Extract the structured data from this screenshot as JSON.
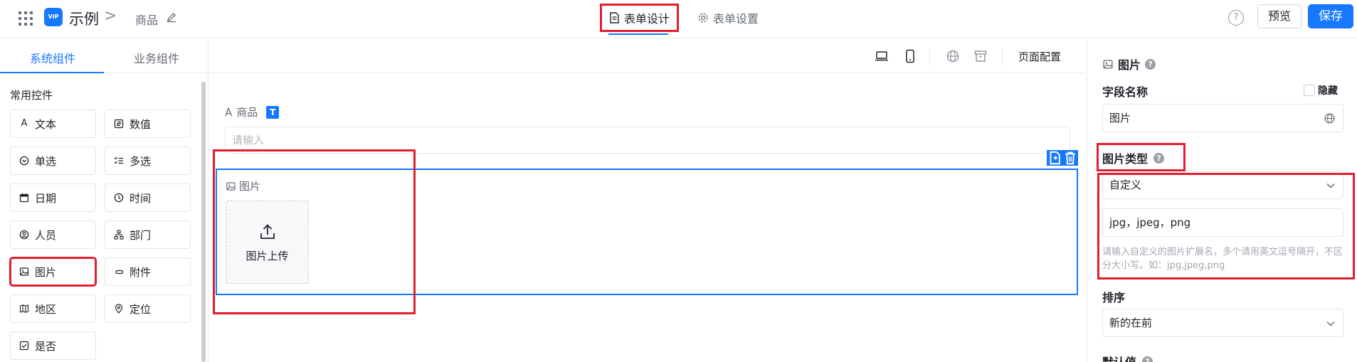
{
  "header": {
    "app_logo_text": "VIP",
    "app_title": "示例",
    "breadcrumb_separator": ">",
    "page_name": "商品",
    "tabs": [
      {
        "label": "表单设计"
      },
      {
        "label": "表单设置"
      }
    ],
    "help_glyph": "?",
    "preview_label": "预览",
    "save_label": "保存"
  },
  "sidebar": {
    "tabs": [
      {
        "label": "系统组件"
      },
      {
        "label": "业务组件"
      }
    ],
    "group_title": "常用控件",
    "components": [
      {
        "label": "文本",
        "icon": "text-icon"
      },
      {
        "label": "数值",
        "icon": "number-icon"
      },
      {
        "label": "单选",
        "icon": "radio-icon"
      },
      {
        "label": "多选",
        "icon": "checklist-icon"
      },
      {
        "label": "日期",
        "icon": "calendar-icon"
      },
      {
        "label": "时间",
        "icon": "clock-icon"
      },
      {
        "label": "人员",
        "icon": "user-icon"
      },
      {
        "label": "部门",
        "icon": "org-icon"
      },
      {
        "label": "图片",
        "icon": "image-icon"
      },
      {
        "label": "附件",
        "icon": "attachment-icon"
      },
      {
        "label": "地区",
        "icon": "map-icon"
      },
      {
        "label": "定位",
        "icon": "location-icon"
      },
      {
        "label": "是否",
        "icon": "checkbox-icon"
      }
    ]
  },
  "canvas": {
    "toolbar": {
      "page_config_label": "页面配置"
    },
    "text_field": {
      "prefix": "A",
      "label": "商品",
      "badge": "T",
      "placeholder": "请输入"
    },
    "image_field": {
      "label": "图片",
      "upload_label": "图片上传"
    }
  },
  "panel": {
    "title": "图片",
    "field_name_label": "字段名称",
    "hide_label": "隐藏",
    "field_name_value": "图片",
    "image_type_label": "图片类型",
    "image_type_value": "自定义",
    "extensions_value": "jpg，jpeg，png",
    "extensions_help": "请输入自定义的图片扩展名，多个请用英文逗号隔开，不区分大小写。如：jpg,jpeg,png",
    "sort_label": "排序",
    "sort_value": "新的在前",
    "default_label": "默认值",
    "help_glyph": "?"
  },
  "colors": {
    "accent": "#1677ff",
    "highlight": "#e11d2e"
  }
}
